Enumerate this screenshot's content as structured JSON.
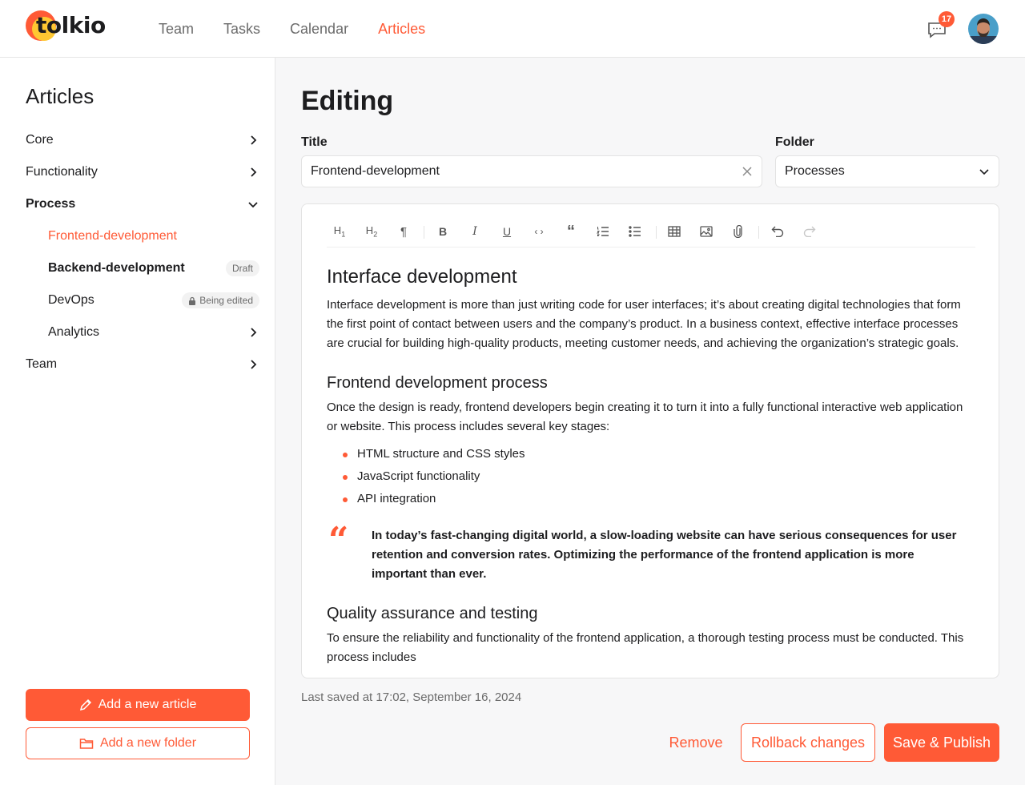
{
  "brand": {
    "name": "tolkio",
    "accent": "#ff5a36",
    "accent_secondary": "#ffc832"
  },
  "nav": [
    {
      "label": "Team",
      "active": false
    },
    {
      "label": "Tasks",
      "active": false
    },
    {
      "label": "Calendar",
      "active": false
    },
    {
      "label": "Articles",
      "active": true
    }
  ],
  "header": {
    "notifications_count": "17",
    "chat_icon": "chat-icon",
    "avatar": "user-avatar"
  },
  "sidebar": {
    "title": "Articles",
    "items": [
      {
        "label": "Core",
        "icon": "chevron-right-icon"
      },
      {
        "label": "Functionality",
        "icon": "chevron-right-icon"
      },
      {
        "label": "Process",
        "icon": "chevron-down-icon",
        "expanded": true
      },
      {
        "label": "Frontend-development",
        "active": true
      },
      {
        "label": "Backend-development",
        "tag": "Draft"
      },
      {
        "label": "DevOps",
        "tag": "Being edited",
        "tag_icon": "lock-icon"
      },
      {
        "label": "Analytics",
        "icon": "chevron-right-icon"
      },
      {
        "label": "Team",
        "icon": "chevron-right-icon"
      }
    ],
    "add_article": "Add a new article",
    "add_folder": "Add a new folder"
  },
  "main": {
    "title": "Editing",
    "title_label": "Title",
    "title_value": "Frontend-development",
    "folder_label": "Folder",
    "folder_value": "Processes",
    "toolbar": [
      "h1-icon",
      "h2-icon",
      "paragraph-icon",
      "bold-icon",
      "italic-icon",
      "underline-icon",
      "code-icon",
      "quote-icon",
      "ordered-list-icon",
      "bullet-list-icon",
      "table-icon",
      "image-icon",
      "attachment-icon",
      "undo-icon",
      "redo-icon"
    ],
    "document": {
      "h1": "Interface development",
      "p1": "Interface development is more than just writing code for user interfaces; it’s about creating digital technologies that form the first point of contact between users and the company’s product. In a business context, effective interface processes are crucial for building high-quality products, meeting customer needs, and achieving the organization’s strategic goals.",
      "h2a": "Frontend development process",
      "p2": "Once the design is ready, frontend developers begin creating it to turn it into a fully functional interactive web application or website. This process includes several key stages:",
      "list": [
        "HTML structure and CSS styles",
        "JavaScript functionality",
        "API integration"
      ],
      "quote": "In today’s fast-changing digital world, a slow-loading website can have serious consequences for user retention and conversion rates. Optimizing the performance of the frontend application is more important than ever.",
      "h2b": "Quality assurance and testing",
      "p3": "To ensure the reliability and functionality of the frontend application, a thorough testing process must be conducted. This process includes"
    },
    "last_saved": "Last saved at 17:02, September 16, 2024",
    "remove": "Remove",
    "rollback": "Rollback changes",
    "publish": "Save & Publish"
  }
}
